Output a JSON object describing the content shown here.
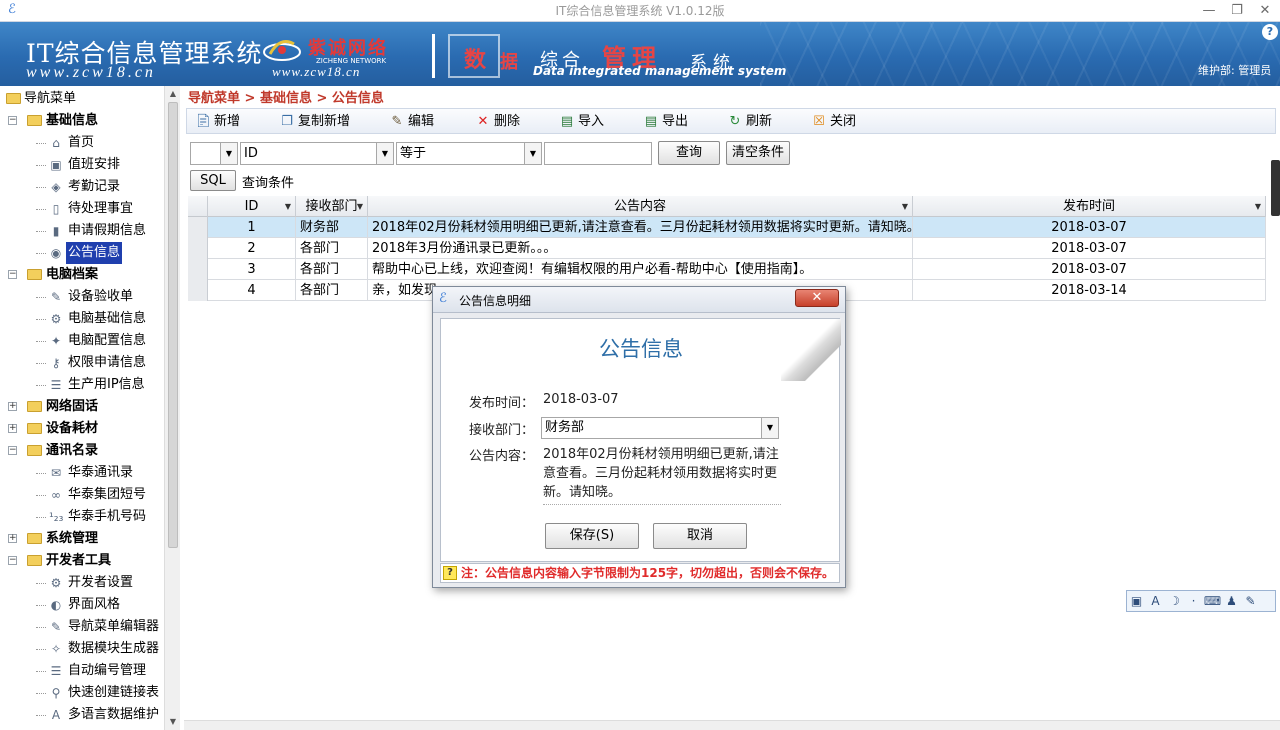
{
  "window": {
    "title": "IT综合信息管理系统 V1.0.12版",
    "min": "—",
    "restore": "❐",
    "close": "✕"
  },
  "banner": {
    "title": "IT综合信息管理系统",
    "url": "www.zcw18.cn",
    "logo_cn": "紫诚网络",
    "logo_en": "ZICHENG NETWORK",
    "logo_url": "www.zcw18.cn",
    "d1": "数",
    "d2": "据",
    "d3": "综合",
    "d4": "管理",
    "d5": "系统",
    "subtitle": "Data integrated management system",
    "user": "维护部: 管理员",
    "help": "?"
  },
  "tree": {
    "root": "导航菜单",
    "groups": [
      {
        "label": "基础信息",
        "expanded": true,
        "items": [
          {
            "label": "首页",
            "icon": "house-icon",
            "glyph": "⌂"
          },
          {
            "label": "值班安排",
            "icon": "user-card-icon",
            "glyph": "▣"
          },
          {
            "label": "考勤记录",
            "icon": "bag-icon",
            "glyph": "◈"
          },
          {
            "label": "待处理事宜",
            "icon": "document-icon",
            "glyph": "▯"
          },
          {
            "label": "申请假期信息",
            "icon": "door-icon",
            "glyph": "▮"
          },
          {
            "label": "公告信息",
            "icon": "person-icon",
            "glyph": "◉",
            "selected": true
          }
        ]
      },
      {
        "label": "电脑档案",
        "expanded": true,
        "items": [
          {
            "label": "设备验收单",
            "icon": "tools-icon",
            "glyph": "✎"
          },
          {
            "label": "电脑基础信息",
            "icon": "gear-icon",
            "glyph": "⚙"
          },
          {
            "label": "电脑配置信息",
            "icon": "puzzle-icon",
            "glyph": "✦"
          },
          {
            "label": "权限申请信息",
            "icon": "key-icon",
            "glyph": "⚷"
          },
          {
            "label": "生产用IP信息",
            "icon": "list-icon",
            "glyph": "☰"
          }
        ]
      },
      {
        "label": "网络固话",
        "expanded": false,
        "items": []
      },
      {
        "label": "设备耗材",
        "expanded": false,
        "items": []
      },
      {
        "label": "通讯名录",
        "expanded": true,
        "items": [
          {
            "label": "华泰通讯录",
            "icon": "envelope-icon",
            "glyph": "✉"
          },
          {
            "label": "华泰集团短号",
            "icon": "link-icon",
            "glyph": "∞"
          },
          {
            "label": "华泰手机号码",
            "icon": "numbers-icon",
            "glyph": "¹₂₃"
          }
        ]
      },
      {
        "label": "系统管理",
        "expanded": false,
        "items": []
      },
      {
        "label": "开发者工具",
        "expanded": true,
        "items": [
          {
            "label": "开发者设置",
            "icon": "gear-icon",
            "glyph": "⚙"
          },
          {
            "label": "界面风格",
            "icon": "palette-icon",
            "glyph": "◐"
          },
          {
            "label": "导航菜单编辑器",
            "icon": "edit-icon",
            "glyph": "✎"
          },
          {
            "label": "数据模块生成器",
            "icon": "wand-icon",
            "glyph": "✧"
          },
          {
            "label": "自动编号管理",
            "icon": "list-icon",
            "glyph": "☰"
          },
          {
            "label": "快速创建链接表",
            "icon": "link-icon",
            "glyph": "⚲"
          },
          {
            "label": "多语言数据维护",
            "icon": "text-icon",
            "glyph": "A"
          }
        ]
      }
    ]
  },
  "breadcrumb": "导航菜单 > 基础信息 > 公告信息",
  "toolbar": {
    "new": "新增",
    "copy_new": "复制新增",
    "edit": "编辑",
    "delete": "删除",
    "import": "导入",
    "export": "导出",
    "refresh": "刷新",
    "close": "关闭"
  },
  "query": {
    "field": "ID",
    "operator": "等于",
    "value": "",
    "search": "查询",
    "clear": "清空条件",
    "sql": "SQL",
    "sql_label": "查询条件"
  },
  "table": {
    "headers": [
      "ID",
      "接收部门",
      "公告内容",
      "发布时间"
    ],
    "rows": [
      {
        "id": "1",
        "dept": "财务部",
        "content": "2018年02月份耗材领用明细已更新,请注意查看。三月份起耗材领用数据将实时更新。请知晓。",
        "time": "2018-03-07"
      },
      {
        "id": "2",
        "dept": "各部门",
        "content": "2018年3月份通讯录已更新。。。",
        "time": "2018-03-07"
      },
      {
        "id": "3",
        "dept": "各部门",
        "content": "帮助中心已上线，欢迎查阅！有编辑权限的用户必看-帮助中心【使用指南】。",
        "time": "2018-03-07"
      },
      {
        "id": "4",
        "dept": "各部门",
        "content": "亲，如发现",
        "time": "2018-03-14"
      }
    ]
  },
  "dialog": {
    "title": "公告信息明细",
    "heading": "公告信息",
    "time_label": "发布时间：",
    "time_value": "2018-03-07",
    "dept_label": "接收部门：",
    "dept_value": "财务部",
    "content_label": "公告内容：",
    "content_value": "2018年02月份耗材领用明细已更新,请注意查看。三月份起耗材领用数据将实时更新。请知晓。",
    "save": "保存(S)",
    "cancel": "取消",
    "warning": "注：公告信息内容输入字节限制为125字，切勿超出，否则会不保存。"
  }
}
